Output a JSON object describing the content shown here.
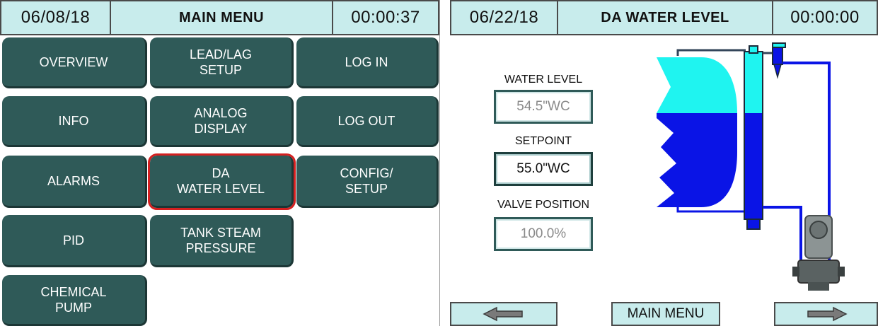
{
  "left_screen": {
    "header": {
      "date": "06/08/18",
      "title": "MAIN MENU",
      "time": "00:00:37"
    },
    "buttons": {
      "overview": [
        "OVERVIEW"
      ],
      "lead_lag": [
        "LEAD/LAG",
        "SETUP"
      ],
      "log_in": [
        "LOG IN"
      ],
      "info": [
        "INFO"
      ],
      "analog_display": [
        "ANALOG",
        "DISPLAY"
      ],
      "log_out": [
        "LOG OUT"
      ],
      "alarms": [
        "ALARMS"
      ],
      "da_water_level": [
        "DA",
        "WATER LEVEL"
      ],
      "config_setup": [
        "CONFIG/",
        "SETUP"
      ],
      "pid": [
        "PID"
      ],
      "tank_steam": [
        "TANK STEAM",
        "PRESSURE"
      ],
      "chemical_pump": [
        "CHEMICAL",
        "PUMP"
      ]
    },
    "selected_button": "DA WATER LEVEL"
  },
  "right_screen": {
    "header": {
      "date": "06/22/18",
      "title": "DA WATER LEVEL",
      "time": "00:00:00"
    },
    "fields": {
      "water_level_label": "WATER LEVEL",
      "water_level_value": "54.5\"WC",
      "setpoint_label": "SETPOINT",
      "setpoint_value": "55.0\"WC",
      "valve_position_label": "VALVE POSITION",
      "valve_position_value": "100.0%"
    },
    "nav": {
      "back_icon": "left-arrow-icon",
      "main_menu": "MAIN MENU",
      "forward_icon": "right-arrow-icon"
    }
  },
  "colors": {
    "header_bg": "#c8ecec",
    "button_bg": "#2f5a58",
    "selection_outline": "#d42020",
    "water": "#0a14e6",
    "steam": "#1ff4f0"
  }
}
